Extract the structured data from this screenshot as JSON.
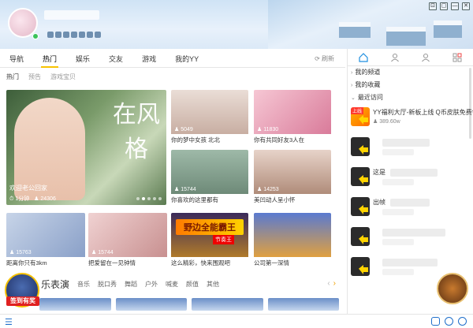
{
  "header": {
    "window_buttons": [
      "⊡",
      "▢",
      "—",
      "✕"
    ]
  },
  "nav": {
    "tabs": [
      "导航",
      "热门",
      "娱乐",
      "交友",
      "游戏",
      "我的YY"
    ],
    "active": "热门",
    "refresh": "刷新"
  },
  "subnav": [
    "热门",
    "预告",
    "游戏宝贝"
  ],
  "featured": {
    "title": "欢迎老公回家",
    "duration": "1分钟",
    "viewers": "24306",
    "calligraphy": "在风格"
  },
  "cards_row1": [
    {
      "count": "5049",
      "caption": "你的梦中女孩 北北"
    },
    {
      "count": "11830",
      "caption": "你有共同好友3人在"
    }
  ],
  "cards_row2": [
    {
      "count": "15744",
      "caption": "你喜欢的这里都有"
    },
    {
      "count": "14253",
      "caption": "美凹动人呈小怀"
    }
  ],
  "cards_row3": [
    {
      "count": "15763",
      "caption": "距离你只有3km"
    },
    {
      "count": "15744",
      "caption": "把爱留在一见钟情"
    },
    {
      "count": "",
      "caption": "这么精彩，快来围观吧",
      "banner": "野边全能霸王",
      "sub": "节奏王"
    },
    {
      "count": "",
      "caption": "公司第一深情"
    }
  ],
  "section": {
    "title": "乐表演",
    "tabs": [
      "音乐",
      "脱口秀",
      "舞蹈",
      "户外",
      "喊麦",
      "颜值",
      "其他"
    ]
  },
  "sign_badge": "签到有奖",
  "right_panel": {
    "categories": [
      "我的频道",
      "我的收藏",
      "最近访问"
    ],
    "recent": [
      {
        "title": "YY福利大厅-新板上线 Q币皮肤免费领",
        "sub": "389.60w",
        "tag": "上线"
      },
      {
        "title": "",
        "sub": ""
      },
      {
        "title": "这是",
        "sub": ""
      },
      {
        "title": "出帧",
        "sub": ""
      },
      {
        "title": "",
        "sub": ""
      },
      {
        "title": "",
        "sub": ""
      },
      {
        "title": "相",
        "sub": ""
      }
    ]
  }
}
